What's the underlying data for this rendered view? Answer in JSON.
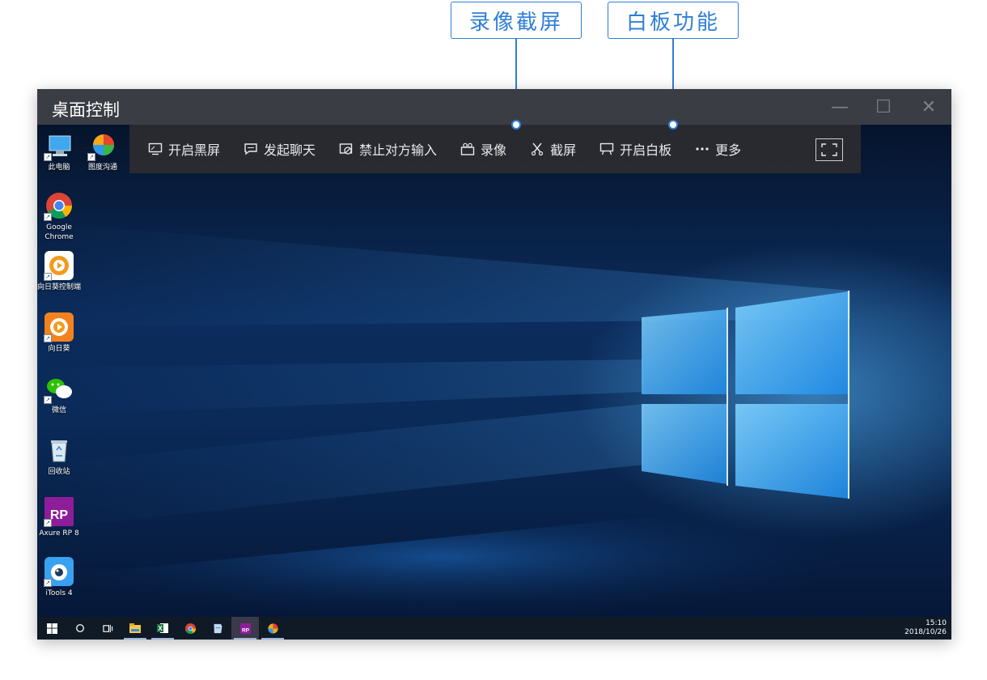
{
  "callouts": {
    "record_screenshot": "录像截屏",
    "whiteboard": "白板功能"
  },
  "window": {
    "title": "桌面控制",
    "minimize_glyph": "—",
    "maximize_glyph": "☐",
    "close_glyph": "✕"
  },
  "toolbar": {
    "items": [
      {
        "label": "开启黑屏",
        "icon": "monitor-icon"
      },
      {
        "label": "发起聊天",
        "icon": "chat-icon"
      },
      {
        "label": "禁止对方输入",
        "icon": "no-input-icon"
      },
      {
        "label": "录像",
        "icon": "camera-icon"
      },
      {
        "label": "截屏",
        "icon": "scissors-icon"
      },
      {
        "label": "开启白板",
        "icon": "whiteboard-icon"
      },
      {
        "label": "更多",
        "icon": "more-dots-icon"
      }
    ],
    "fullscreen_icon": "fullscreen-icon"
  },
  "desktop_icons": [
    {
      "label": "此电脑",
      "icon": "computer-icon"
    },
    {
      "label": "图度沟通",
      "icon": "colorful-ball-icon"
    },
    {
      "label": "Google Chrome",
      "icon": "chrome-icon"
    },
    {
      "label": "向日葵控制端",
      "icon": "sunflower-control-icon"
    },
    {
      "label": "向日葵",
      "icon": "sunflower-icon"
    },
    {
      "label": "微信",
      "icon": "wechat-icon"
    },
    {
      "label": "回收站",
      "icon": "recycle-bin-icon"
    },
    {
      "label": "Axure RP 8",
      "icon": "axure-icon"
    },
    {
      "label": "iTools 4",
      "icon": "itools-icon"
    }
  ],
  "taskbar": {
    "time": "15:10",
    "date": "2018/10/26",
    "items": [
      "windows-start-icon",
      "search-circle-icon",
      "task-view-icon",
      "file-explorer-icon",
      "excel-icon",
      "chrome-icon",
      "notepad-icon",
      "axure-icon",
      "colorful-ball-icon"
    ]
  },
  "colors": {
    "accent": "#2f7ed8",
    "titlebar": "#3b3d45",
    "toolbar": "#2c2c30"
  }
}
